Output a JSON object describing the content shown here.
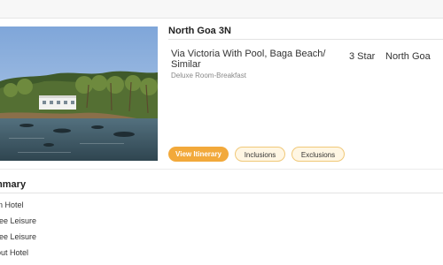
{
  "hotel_card": {
    "city_title": "North Goa 3N",
    "hotel_name": "Via Victoria With Pool, Baga Beach/ Similar",
    "room_type": "Deluxe Room-Breakfast",
    "star_rating": "3 Star",
    "location": "North Goa",
    "photo_icon": "beach-photo",
    "buttons": {
      "itinerary": "View Itinerary",
      "inclusions": "Inclusions",
      "exclusions": "Exclusions"
    }
  },
  "summary": {
    "title": "mmary",
    "items": [
      "in Hotel",
      "ree Leisure",
      "ree Leisure",
      "out Hotel"
    ]
  },
  "colors": {
    "accent": "#f2a93b",
    "button_outline_bg": "#fff6e3",
    "button_outline_border": "#f0c878"
  }
}
